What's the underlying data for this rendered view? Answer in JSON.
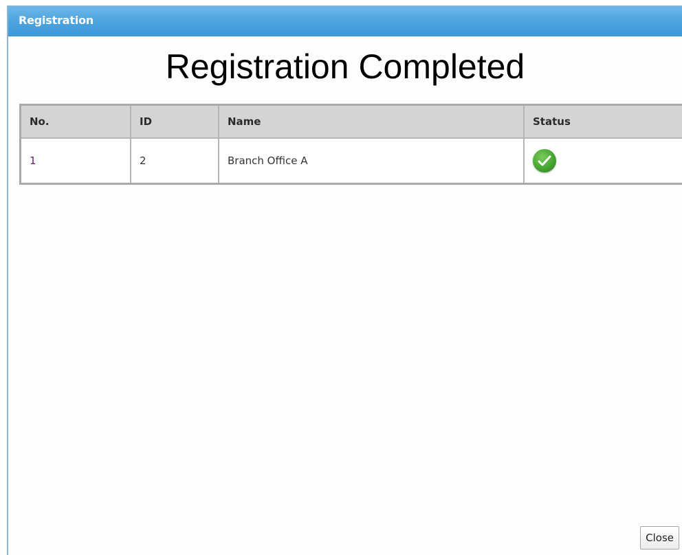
{
  "window": {
    "title": "Registration"
  },
  "page": {
    "heading": "Registration Completed"
  },
  "table": {
    "columns": [
      "No.",
      "ID",
      "Name",
      "Status"
    ],
    "rows": [
      {
        "no": "1",
        "id": "2",
        "name": "Branch Office A",
        "status_icon": "success-check-icon"
      }
    ]
  },
  "footer": {
    "close_label": "Close"
  },
  "colors": {
    "titlebar": "#4aa3df",
    "header_bg": "#d4d4d4",
    "status_success": "#46a530"
  }
}
